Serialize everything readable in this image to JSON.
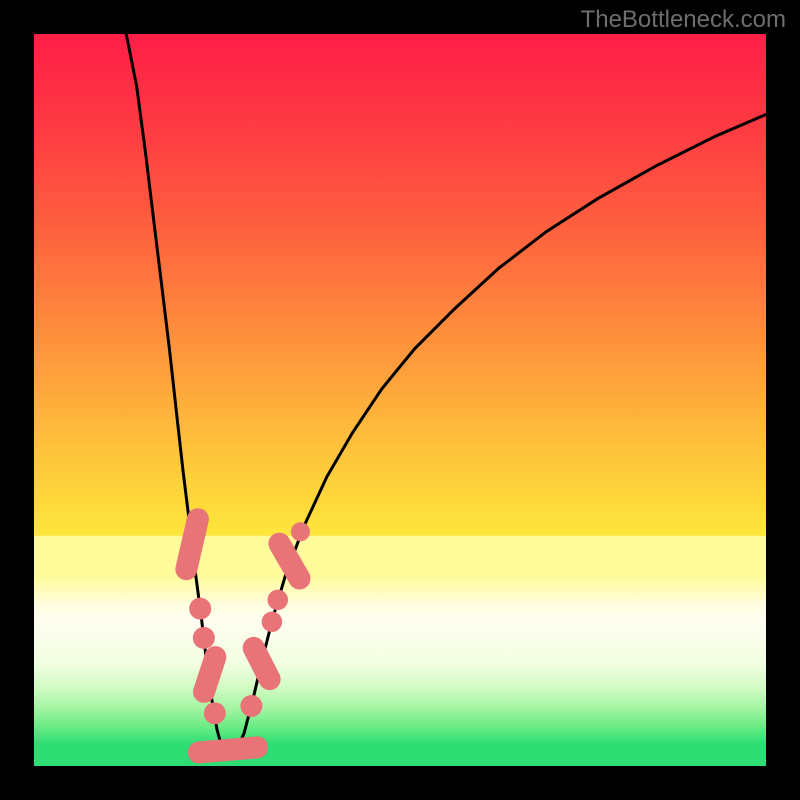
{
  "watermark": "TheBottleneck.com",
  "colors": {
    "frame": "#000000",
    "watermark": "#6d6d6d",
    "curve": "#000000",
    "markers_fill": "#e97477",
    "markers_stroke": "#d55b5e",
    "green_band": "#2fdd75"
  },
  "gradient_stops": [
    {
      "offset": 0.0,
      "color": "#fe1f47"
    },
    {
      "offset": 0.07,
      "color": "#fe2d44"
    },
    {
      "offset": 0.14,
      "color": "#fe3e42"
    },
    {
      "offset": 0.21,
      "color": "#fe5140"
    },
    {
      "offset": 0.28,
      "color": "#fe653e"
    },
    {
      "offset": 0.35,
      "color": "#fe7b3d"
    },
    {
      "offset": 0.42,
      "color": "#fe923c"
    },
    {
      "offset": 0.49,
      "color": "#fea93b"
    },
    {
      "offset": 0.56,
      "color": "#fec03b"
    },
    {
      "offset": 0.63,
      "color": "#fed63b"
    },
    {
      "offset": 0.685,
      "color": "#fee63c"
    },
    {
      "offset": 0.686,
      "color": "#fffb9a"
    },
    {
      "offset": 0.74,
      "color": "#fffb9a"
    },
    {
      "offset": 0.78,
      "color": "#fffde0"
    },
    {
      "offset": 0.8,
      "color": "#fffef0"
    },
    {
      "offset": 0.86,
      "color": "#f1ffe1"
    },
    {
      "offset": 0.89,
      "color": "#d4fbc6"
    },
    {
      "offset": 0.92,
      "color": "#a6f5a4"
    },
    {
      "offset": 0.945,
      "color": "#6dec85"
    },
    {
      "offset": 0.97,
      "color": "#2fdd75"
    },
    {
      "offset": 1.0,
      "color": "#2fdd75"
    }
  ],
  "chart_data": {
    "type": "line",
    "title": "",
    "xlabel": "",
    "ylabel": "",
    "xlim": [
      0,
      1
    ],
    "ylim": [
      0,
      1
    ],
    "note": "x and y are fractions of the 732x732 plot area, origin at top-left. The curve descends from near top-left to a minimum at x≈0.26, y≈0.985, then rises toward the upper-right.",
    "series": [
      {
        "name": "bottleneck-curve",
        "points": [
          {
            "x": 0.126,
            "y": 0.0
          },
          {
            "x": 0.14,
            "y": 0.07
          },
          {
            "x": 0.152,
            "y": 0.16
          },
          {
            "x": 0.163,
            "y": 0.25
          },
          {
            "x": 0.174,
            "y": 0.34
          },
          {
            "x": 0.185,
            "y": 0.43
          },
          {
            "x": 0.195,
            "y": 0.52
          },
          {
            "x": 0.204,
            "y": 0.6
          },
          {
            "x": 0.214,
            "y": 0.68
          },
          {
            "x": 0.221,
            "y": 0.74
          },
          {
            "x": 0.229,
            "y": 0.8
          },
          {
            "x": 0.236,
            "y": 0.86
          },
          {
            "x": 0.243,
            "y": 0.91
          },
          {
            "x": 0.25,
            "y": 0.95
          },
          {
            "x": 0.258,
            "y": 0.98
          },
          {
            "x": 0.265,
            "y": 0.985
          },
          {
            "x": 0.276,
            "y": 0.98
          },
          {
            "x": 0.287,
            "y": 0.955
          },
          {
            "x": 0.3,
            "y": 0.905
          },
          {
            "x": 0.313,
            "y": 0.85
          },
          {
            "x": 0.327,
            "y": 0.795
          },
          {
            "x": 0.345,
            "y": 0.735
          },
          {
            "x": 0.37,
            "y": 0.67
          },
          {
            "x": 0.4,
            "y": 0.605
          },
          {
            "x": 0.435,
            "y": 0.545
          },
          {
            "x": 0.475,
            "y": 0.485
          },
          {
            "x": 0.52,
            "y": 0.43
          },
          {
            "x": 0.575,
            "y": 0.375
          },
          {
            "x": 0.635,
            "y": 0.32
          },
          {
            "x": 0.7,
            "y": 0.27
          },
          {
            "x": 0.77,
            "y": 0.225
          },
          {
            "x": 0.85,
            "y": 0.18
          },
          {
            "x": 0.93,
            "y": 0.14
          },
          {
            "x": 1.0,
            "y": 0.11
          }
        ]
      }
    ],
    "markers": [
      {
        "name": "left-cluster-top",
        "shape": "capsule",
        "x": 0.216,
        "y": 0.697,
        "len": 0.07,
        "angle": -77
      },
      {
        "name": "left-dot-1",
        "shape": "dot",
        "x": 0.227,
        "y": 0.785,
        "r": 0.015
      },
      {
        "name": "left-dot-2",
        "shape": "dot",
        "x": 0.232,
        "y": 0.825,
        "r": 0.015
      },
      {
        "name": "left-capsule-2",
        "shape": "capsule",
        "x": 0.24,
        "y": 0.875,
        "len": 0.05,
        "angle": -72
      },
      {
        "name": "left-dot-3",
        "shape": "dot",
        "x": 0.247,
        "y": 0.928,
        "r": 0.015
      },
      {
        "name": "bottom-capsule",
        "shape": "capsule",
        "x": 0.265,
        "y": 0.978,
        "len": 0.08,
        "angle": -5
      },
      {
        "name": "right-dot-1",
        "shape": "dot",
        "x": 0.297,
        "y": 0.918,
        "r": 0.015
      },
      {
        "name": "right-capsule-1",
        "shape": "capsule",
        "x": 0.311,
        "y": 0.86,
        "len": 0.048,
        "angle": 63
      },
      {
        "name": "right-dot-2",
        "shape": "dot",
        "x": 0.325,
        "y": 0.803,
        "r": 0.014
      },
      {
        "name": "right-dot-3",
        "shape": "dot",
        "x": 0.333,
        "y": 0.773,
        "r": 0.014
      },
      {
        "name": "right-capsule-2",
        "shape": "capsule",
        "x": 0.349,
        "y": 0.72,
        "len": 0.055,
        "angle": 60
      },
      {
        "name": "right-dot-4",
        "shape": "dot",
        "x": 0.364,
        "y": 0.68,
        "r": 0.013
      }
    ]
  }
}
